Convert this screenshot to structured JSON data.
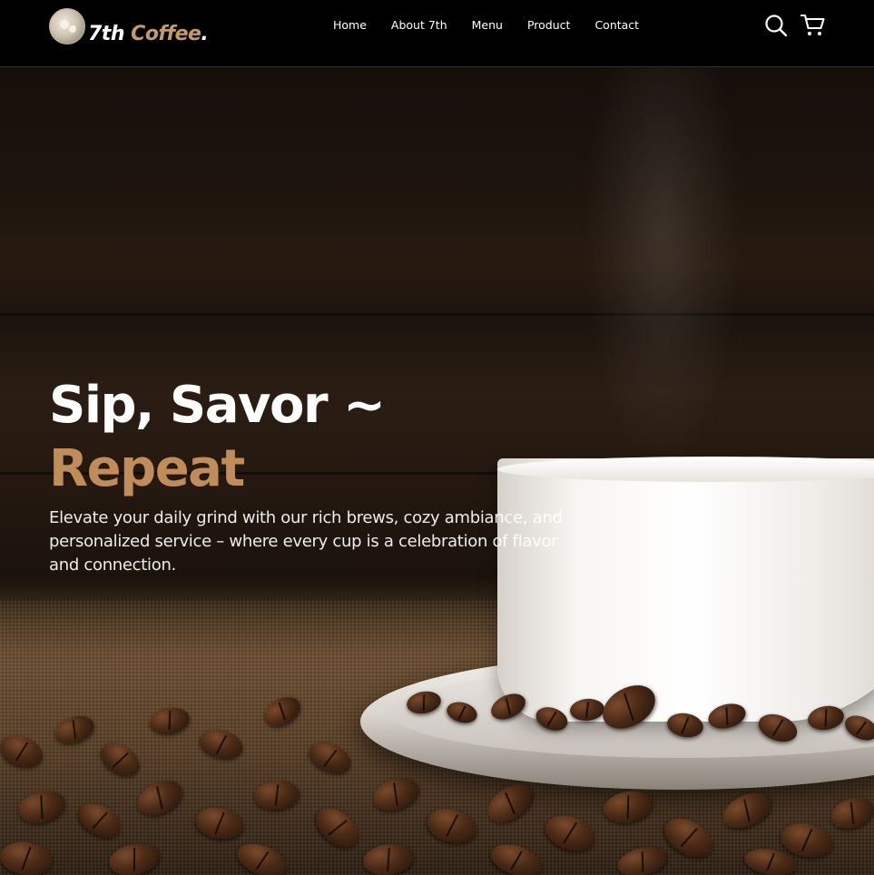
{
  "brand": {
    "logo_number": "7th",
    "logo_name": "Coffee",
    "logo_dot": ".",
    "accent_color": "#c08c5a"
  },
  "nav": {
    "items": [
      {
        "label": "Home"
      },
      {
        "label": "About 7th"
      },
      {
        "label": "Menu"
      },
      {
        "label": "Product"
      },
      {
        "label": "Contact"
      }
    ],
    "icons": [
      "search-icon",
      "cart-icon"
    ]
  },
  "hero": {
    "title_line1": "Sip, Savor ~",
    "title_line2": "Repeat",
    "description": "Elevate your daily grind with our rich brews, cozy ambiance, and personalized service – where every cup is a celebration of flavor and connection."
  }
}
